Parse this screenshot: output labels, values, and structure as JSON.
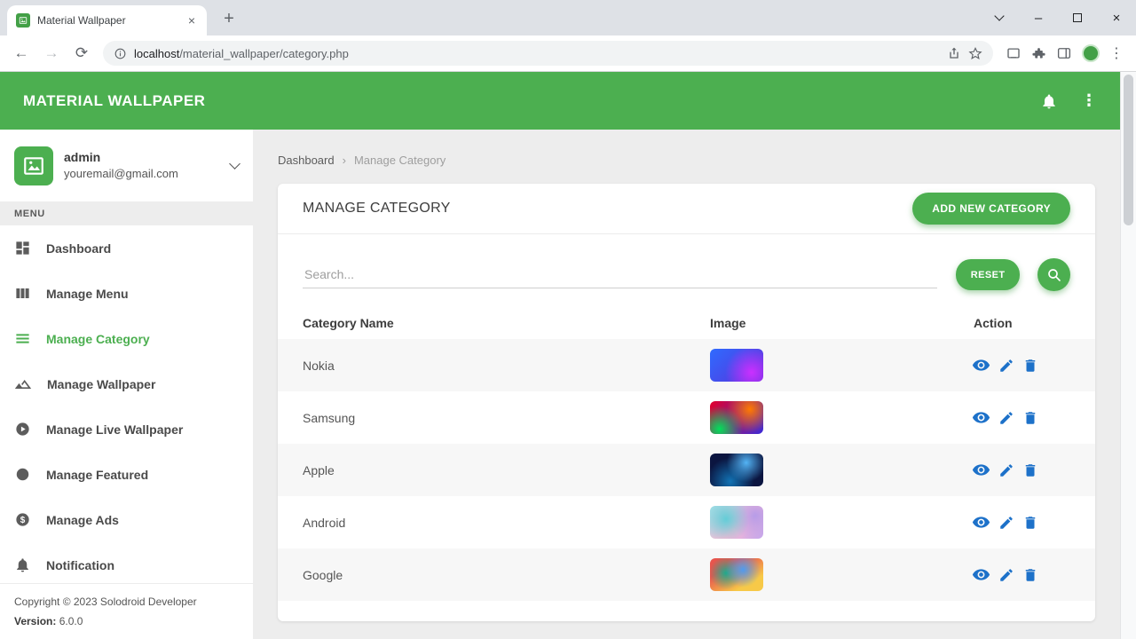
{
  "colors": {
    "accent_green": "#4caf50",
    "action_blue": "#1d71c9",
    "main_background": "#ededed"
  },
  "browser": {
    "tab_title": "Material Wallpaper",
    "url_host": "localhost",
    "url_path": "/material_wallpaper/category.php",
    "glyphs": {
      "close_tab": "×",
      "new_tab": "+",
      "back": "←",
      "forward": "→",
      "reload": "⟳",
      "minimize": "–",
      "close_window": "×",
      "more": "⋮"
    }
  },
  "app_header": {
    "title": "MATERIAL WALLPAPER",
    "more": "⋮"
  },
  "sidebar": {
    "user": {
      "name": "admin",
      "email": "youremail@gmail.com"
    },
    "menu_label": "MENU",
    "items": [
      {
        "label": "Dashboard",
        "active": false
      },
      {
        "label": "Manage Menu",
        "active": false
      },
      {
        "label": "Manage Category",
        "active": true
      },
      {
        "label": "Manage Wallpaper",
        "active": false
      },
      {
        "label": "Manage Live Wallpaper",
        "active": false
      },
      {
        "label": "Manage Featured",
        "active": false
      },
      {
        "label": "Manage Ads",
        "active": false
      },
      {
        "label": "Notification",
        "active": false
      }
    ],
    "footer": {
      "copyright": "Copyright © 2023 Solodroid Developer",
      "version_label": "Version:",
      "version_value": "6.0.0"
    }
  },
  "main": {
    "breadcrumb": {
      "home": "Dashboard",
      "sep": "›",
      "current": "Manage Category"
    },
    "card": {
      "title": "MANAGE CATEGORY",
      "add_button": "ADD NEW CATEGORY",
      "search_placeholder": "Search...",
      "reset_button": "RESET",
      "table": {
        "headers": [
          "Category Name",
          "Image",
          "Action"
        ],
        "rows": [
          {
            "name": "Nokia",
            "thumb_style": "background:radial-gradient(circle at 78% 72%, #cb30ff 0%, rgba(203,48,255,0) 55%), linear-gradient(135deg, #2f6bff 0%, #5a2fd9 100%)"
          },
          {
            "name": "Samsung",
            "thumb_style": "background:radial-gradient(circle at 18% 85%, #00e05a 0%, rgba(0,224,90,0) 45%), radial-gradient(circle at 75% 25%, #ff7a00 0%, rgba(255,122,0,0) 50%), linear-gradient(120deg, #e4002b 0%, #3b2bd9 100%)"
          },
          {
            "name": "Apple",
            "thumb_style": "background:radial-gradient(circle at 68% 28%, #53b4f5 0%, rgba(83,180,245,0) 45%), radial-gradient(circle at 38% 85%, #1273b4 0%, rgba(18,115,180,0) 55%), #0b1540"
          },
          {
            "name": "Android",
            "thumb_style": "background:radial-gradient(circle at 30% 40%, #63cdd7 0%, rgba(99,205,215,0) 55%), radial-gradient(circle at 85% 30%, #b79ce8 0%, rgba(183,156,232,0) 50%), linear-gradient(135deg, #a6e3e9 0%, #f7b9d4 55%, #c7a8ec 100%)"
          },
          {
            "name": "Google",
            "thumb_style": "background:radial-gradient(circle at 62% 35%, #4e9bf0 0%, rgba(78,155,240,0) 45%), radial-gradient(circle at 30% 45%, #1fa98c 0%, rgba(31,169,140,0) 40%), linear-gradient(150deg, #e8554d 0%, #e8554d 30%, #f7c948 75%, #f7c948 100%)"
          }
        ]
      }
    }
  }
}
